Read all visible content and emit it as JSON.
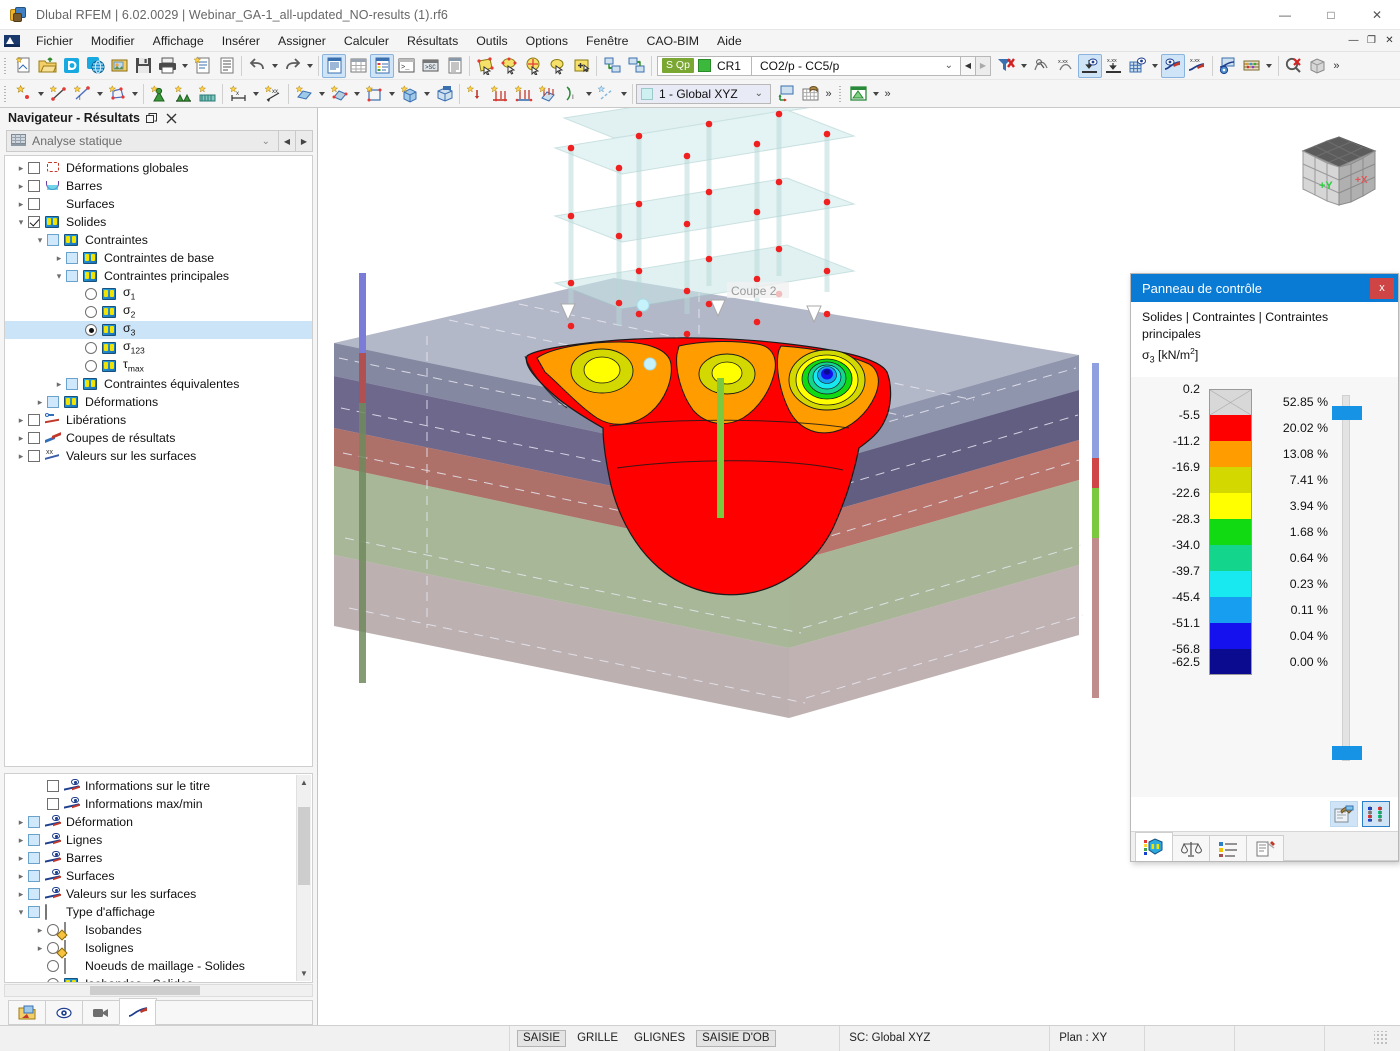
{
  "window": {
    "title": "Dlubal RFEM | 6.02.0029 | Webinar_GA-1_all-updated_NO-results (1).rf6",
    "app_icon": "rfem-logo-icon",
    "minimize": "—",
    "maximize": "□",
    "close": "✕"
  },
  "menu": {
    "logo_icon": "dlubal-flag-icon",
    "items": [
      "Fichier",
      "Modifier",
      "Affichage",
      "Insérer",
      "Assigner",
      "Calculer",
      "Résultats",
      "Outils",
      "Options",
      "Fenêtre",
      "CAO-BIM",
      "Aide"
    ],
    "mdi": {
      "minimize": "—",
      "restore": "❐",
      "close": "✕"
    }
  },
  "load_case": {
    "tag": "S Qp",
    "swatch_color": "#3cb93c",
    "short_name": "CR1",
    "combo_value": "CO2/p - CC5/p",
    "dropdown_arrow": "⌄",
    "prev": "◀",
    "next": "▶"
  },
  "coord_system": {
    "value": "1 - Global XYZ",
    "dropdown_arrow": "⌄"
  },
  "navigator": {
    "title": "Navigateur - Résultats",
    "undock_icon": "undock-icon",
    "close_icon": "close-icon",
    "analysis_combo": {
      "icon": "analysis-icon",
      "value": "Analyse statique",
      "arrow": "⌄",
      "prev": "◀",
      "next": "▶"
    },
    "tree": [
      {
        "label": "Déformations globales",
        "indent": 0,
        "expander": "▸",
        "control": "checkbox",
        "checked": false,
        "icon": "deformation-icon",
        "selected": false
      },
      {
        "label": "Barres",
        "indent": 0,
        "expander": "▸",
        "control": "checkbox",
        "checked": false,
        "icon": "member-icon",
        "selected": false
      },
      {
        "label": "Surfaces",
        "indent": 0,
        "expander": "▸",
        "control": "checkbox",
        "checked": false,
        "icon": "surface-icon",
        "selected": false
      },
      {
        "label": "Solides",
        "indent": 0,
        "expander": "▾",
        "control": "checkbox",
        "checked": true,
        "icon": "solid-icon",
        "selected": false
      },
      {
        "label": "Contraintes",
        "indent": 1,
        "expander": "▾",
        "control": "checkbox-blue",
        "checked": false,
        "icon": "solid-icon",
        "selected": false
      },
      {
        "label": "Contraintes de base",
        "indent": 2,
        "expander": "▸",
        "control": "checkbox-blue",
        "checked": false,
        "icon": "solid-icon",
        "selected": false
      },
      {
        "label": "Contraintes principales",
        "indent": 2,
        "expander": "▾",
        "control": "checkbox-blue",
        "checked": false,
        "icon": "solid-icon",
        "selected": false
      },
      {
        "label": "σ1",
        "indent": 3,
        "expander": "",
        "control": "radio",
        "checked": false,
        "icon": "solid-icon",
        "selected": false
      },
      {
        "label": "σ2",
        "indent": 3,
        "expander": "",
        "control": "radio",
        "checked": false,
        "icon": "solid-icon",
        "selected": false
      },
      {
        "label": "σ3",
        "indent": 3,
        "expander": "",
        "control": "radio",
        "checked": true,
        "icon": "solid-icon",
        "selected": true
      },
      {
        "label": "σ123",
        "indent": 3,
        "expander": "",
        "control": "radio",
        "checked": false,
        "icon": "solid-icon",
        "selected": false
      },
      {
        "label": "τmax",
        "indent": 3,
        "expander": "",
        "control": "radio",
        "checked": false,
        "icon": "solid-icon",
        "selected": false
      },
      {
        "label": "Contraintes équivalentes",
        "indent": 2,
        "expander": "▸",
        "control": "checkbox-blue",
        "checked": false,
        "icon": "solid-icon",
        "selected": false
      },
      {
        "label": "Déformations",
        "indent": 1,
        "expander": "▸",
        "control": "checkbox-blue",
        "checked": false,
        "icon": "solid-icon",
        "selected": false
      },
      {
        "label": "Libérations",
        "indent": 0,
        "expander": "▸",
        "control": "checkbox",
        "checked": false,
        "icon": "release-icon",
        "selected": false
      },
      {
        "label": "Coupes de résultats",
        "indent": 0,
        "expander": "▸",
        "control": "checkbox",
        "checked": false,
        "icon": "result-section-icon",
        "selected": false
      },
      {
        "label": "Valeurs sur les surfaces",
        "indent": 0,
        "expander": "▸",
        "control": "checkbox",
        "checked": false,
        "icon": "values-on-surfaces-icon",
        "selected": false
      }
    ],
    "display_tree": [
      {
        "label": "Informations sur le titre",
        "indent": 1,
        "expander": "",
        "control": "checkbox",
        "checked": false,
        "icon": "eye-line-icon",
        "selected": false
      },
      {
        "label": "Informations max/min",
        "indent": 1,
        "expander": "",
        "control": "checkbox",
        "checked": false,
        "icon": "eye-line-icon",
        "selected": false
      },
      {
        "label": "Déformation",
        "indent": 0,
        "expander": "▸",
        "control": "checkbox-blue",
        "checked": false,
        "icon": "eye-line-icon",
        "selected": false
      },
      {
        "label": "Lignes",
        "indent": 0,
        "expander": "▸",
        "control": "checkbox-blue",
        "checked": false,
        "icon": "eye-line-icon",
        "selected": false
      },
      {
        "label": "Barres",
        "indent": 0,
        "expander": "▸",
        "control": "checkbox-blue",
        "checked": false,
        "icon": "eye-line-icon",
        "selected": false
      },
      {
        "label": "Surfaces",
        "indent": 0,
        "expander": "▸",
        "control": "checkbox-blue",
        "checked": false,
        "icon": "eye-line-icon",
        "selected": false
      },
      {
        "label": "Valeurs sur les surfaces",
        "indent": 0,
        "expander": "▸",
        "control": "checkbox-blue",
        "checked": false,
        "icon": "eye-line-icon",
        "selected": false
      },
      {
        "label": "Type d'affichage",
        "indent": 0,
        "expander": "▾",
        "control": "checkbox-blue",
        "checked": false,
        "icon": "rainbow-icon",
        "selected": false
      },
      {
        "label": "Isobandes",
        "indent": 1,
        "expander": "▸",
        "control": "radio",
        "checked": false,
        "icon": "isobands-icon",
        "selected": false
      },
      {
        "label": "Isolignes",
        "indent": 1,
        "expander": "▸",
        "control": "radio",
        "checked": false,
        "icon": "isolines-icon",
        "selected": false
      },
      {
        "label": "Noeuds de maillage - Solides",
        "indent": 1,
        "expander": "",
        "control": "radio",
        "checked": false,
        "icon": "mesh-nodes-icon",
        "selected": false
      },
      {
        "label": "Isobandes - Solides",
        "indent": 1,
        "expander": "",
        "control": "radio",
        "checked": true,
        "icon": "solid-icon",
        "selected": false
      }
    ],
    "tabs": [
      {
        "name": "project-navigator-tab",
        "icon": "folder-arrow-icon",
        "selected": false
      },
      {
        "name": "display-navigator-tab",
        "icon": "eye-icon",
        "selected": false
      },
      {
        "name": "views-navigator-tab",
        "icon": "camera-icon",
        "selected": false
      },
      {
        "name": "results-navigator-tab",
        "icon": "result-curve-icon",
        "selected": true
      }
    ]
  },
  "viewport": {
    "section_label": "Coupe 2",
    "navcube": {
      "axis_y": "+Y",
      "axis_x": "+X"
    }
  },
  "control_panel": {
    "title": "Panneau de contrôle",
    "close_label": "x",
    "subtitle_line1": "Solides | Contraintes | Contraintes principales",
    "subtitle_quantity": "σ3",
    "subtitle_unit": "[kN/m2]",
    "legend": {
      "boundaries": [
        "0.2",
        "-5.5",
        "-11.2",
        "-16.9",
        "-22.6",
        "-28.3",
        "-34.0",
        "-39.7",
        "-45.4",
        "-51.1",
        "-56.8",
        "-62.5"
      ],
      "bands": [
        {
          "color": "#d8d8d8",
          "hatched": true,
          "pct": "52.85 %"
        },
        {
          "color": "#fe0000",
          "hatched": false,
          "pct": "20.02 %"
        },
        {
          "color": "#ff9d00",
          "hatched": false,
          "pct": "13.08 %"
        },
        {
          "color": "#d2d800",
          "hatched": false,
          "pct": "7.41 %"
        },
        {
          "color": "#ffff00",
          "hatched": false,
          "pct": "3.94 %"
        },
        {
          "color": "#12da12",
          "hatched": false,
          "pct": "1.68 %"
        },
        {
          "color": "#13d68c",
          "hatched": false,
          "pct": "0.64 %"
        },
        {
          "color": "#18e8ef",
          "hatched": false,
          "pct": "0.23 %"
        },
        {
          "color": "#189ef0",
          "hatched": false,
          "pct": "0.11 %"
        },
        {
          "color": "#1510ee",
          "hatched": false,
          "pct": "0.04 %"
        },
        {
          "color": "#0b0b8f",
          "hatched": false,
          "pct": "0.00 %"
        }
      ]
    },
    "tools": [
      {
        "name": "legend-settings-button",
        "icon": "legend-edit-icon",
        "active": false
      },
      {
        "name": "color-scale-button",
        "icon": "color-scale-icon",
        "active": true
      }
    ],
    "tabs": [
      {
        "name": "color-scale-tab",
        "icon": "color-scale-tab-icon",
        "selected": true
      },
      {
        "name": "factors-tab",
        "icon": "scales-icon",
        "selected": false
      },
      {
        "name": "filter-tab",
        "icon": "list-filter-icon",
        "selected": false
      },
      {
        "name": "display-tab",
        "icon": "clipboard-pin-icon",
        "selected": false
      }
    ]
  },
  "statusbar": {
    "toggles": [
      {
        "label": "SAISIE",
        "on": true
      },
      {
        "label": "GRILLE",
        "on": false
      },
      {
        "label": "GLIGNES",
        "on": false
      },
      {
        "label": "SAISIE D'OB",
        "on": true
      }
    ],
    "coord_system": "SC: Global XYZ",
    "plane": "Plan : XY"
  },
  "toolbar_row1": [
    {
      "name": "new-model-button",
      "icon": "new-doc-star-icon"
    },
    {
      "name": "open-button",
      "icon": "folder-open-icon"
    },
    {
      "name": "dlubal-center-button",
      "icon": "dlubal-d-icon"
    },
    {
      "name": "cloud-button",
      "icon": "cloud-globe-icon"
    },
    {
      "name": "project-info-button",
      "icon": "project-info-icon"
    },
    {
      "name": "save-button",
      "icon": "save-icon"
    },
    {
      "name": "print-button",
      "icon": "printer-icon",
      "caret": true
    },
    {
      "name": "printout-report-button",
      "icon": "report-star-icon"
    },
    {
      "name": "report-button",
      "icon": "document-icon"
    },
    {
      "sep": true
    },
    {
      "name": "undo-button",
      "icon": "undo-icon",
      "caret": true
    },
    {
      "name": "redo-button",
      "icon": "redo-icon",
      "caret": true
    },
    {
      "sep": true
    },
    {
      "name": "table-toggle-button",
      "icon": "table-blue-icon",
      "active": true
    },
    {
      "name": "grid-table-button",
      "icon": "table-grid-icon"
    },
    {
      "name": "result-table-button",
      "icon": "table-color-icon",
      "active": true
    },
    {
      "name": "console-button",
      "icon": "console-icon"
    },
    {
      "name": "script-button",
      "icon": "script-icon"
    },
    {
      "name": "list-button",
      "icon": "list-icon"
    },
    {
      "sep": true
    },
    {
      "name": "select-surface-button",
      "icon": "select-surface-icon"
    },
    {
      "name": "select-single-button",
      "icon": "select-single-icon"
    },
    {
      "name": "select-special-button",
      "icon": "select-special-icon"
    },
    {
      "name": "select-lasso-button",
      "icon": "select-lasso-icon"
    },
    {
      "name": "select-add-button",
      "icon": "select-add-icon"
    },
    {
      "sep": true
    },
    {
      "name": "render-mode-button",
      "icon": "render-icon"
    },
    {
      "name": "render-mode2-button",
      "icon": "render2-icon"
    },
    {
      "sep": true
    },
    {
      "name": "filter-clear-button",
      "icon": "filter-x-icon",
      "caret": true
    },
    {
      "name": "deformation-scale-button",
      "icon": "deform-scale-icon"
    },
    {
      "name": "values-scale-button",
      "icon": "values-scale-icon"
    },
    {
      "name": "show-results-button",
      "icon": "results-eye-icon",
      "active": true
    },
    {
      "name": "show-values-button",
      "icon": "values-down-icon"
    },
    {
      "name": "grid-results-button",
      "icon": "grid-eye-icon",
      "caret": true
    },
    {
      "name": "result-diagram-button",
      "icon": "diagram-eye-icon",
      "active": true
    },
    {
      "name": "result-values-button",
      "icon": "diagram-values-icon"
    },
    {
      "sep": true
    },
    {
      "name": "result-config-button",
      "icon": "diagram-gear-icon"
    },
    {
      "name": "abacus-button",
      "icon": "abacus-icon",
      "caret": true
    },
    {
      "sep": true
    },
    {
      "name": "zoom-reset-button",
      "icon": "zoom-x-icon"
    },
    {
      "name": "view-cube-button",
      "icon": "cube-icon"
    },
    {
      "name": "overflow-chevron",
      "icon": "chevron-right-icon"
    }
  ],
  "toolbar_row2": [
    {
      "name": "new-node-button",
      "icon": "node-star-icon",
      "caret": true
    },
    {
      "name": "new-line-button",
      "icon": "line-star-icon"
    },
    {
      "name": "new-line-type-button",
      "icon": "line-type-star-icon",
      "caret": true
    },
    {
      "name": "new-polyline-button",
      "icon": "polyline-star-icon",
      "caret": true
    },
    {
      "sep": true
    },
    {
      "name": "new-support-button",
      "icon": "support-star-icon"
    },
    {
      "name": "new-line-support-button",
      "icon": "line-support-star-icon"
    },
    {
      "name": "new-surface-support-button",
      "icon": "surface-support-star-icon"
    },
    {
      "sep": true
    },
    {
      "name": "new-dimension-button",
      "icon": "dimension-star-icon",
      "caret": true
    },
    {
      "name": "new-coordinate-button",
      "icon": "coordinate-star-icon"
    },
    {
      "sep": true
    },
    {
      "name": "new-surface-button",
      "icon": "surface-star-icon",
      "caret": true
    },
    {
      "name": "new-surface-set-button",
      "icon": "surface-set-star-icon",
      "caret": true
    },
    {
      "name": "new-opening-button",
      "icon": "opening-star-icon",
      "caret": true
    },
    {
      "name": "new-solid-button",
      "icon": "solid-star-icon",
      "caret": true
    },
    {
      "name": "new-solid-set-button",
      "icon": "solid-set-icon"
    },
    {
      "sep": true
    },
    {
      "name": "new-nodal-load-button",
      "icon": "nodal-load-star-icon"
    },
    {
      "name": "new-line-load-button",
      "icon": "line-load-star-icon"
    },
    {
      "name": "new-member-load-button",
      "icon": "member-load-star-icon"
    },
    {
      "name": "new-surface-load-button",
      "icon": "surface-load-star-icon"
    },
    {
      "name": "new-free-load-button",
      "icon": "free-load-icon",
      "caret": true
    },
    {
      "name": "new-imperfection-button",
      "icon": "imperfection-star-icon",
      "caret": true
    },
    {
      "sep": true
    },
    {
      "name": "coordinate-system-selector",
      "icon": "cs-icon"
    },
    {
      "name": "work-plane-button",
      "icon": "work-plane-icon"
    },
    {
      "name": "grid-settings-button",
      "icon": "grid-settings-icon"
    },
    {
      "name": "overflow-chevron-2",
      "icon": "chevron-right-icon"
    },
    {
      "name": "table-view-button",
      "icon": "table-green-icon",
      "caret": true
    },
    {
      "name": "overflow-chevron-3",
      "icon": "chevron-right-icon"
    }
  ]
}
